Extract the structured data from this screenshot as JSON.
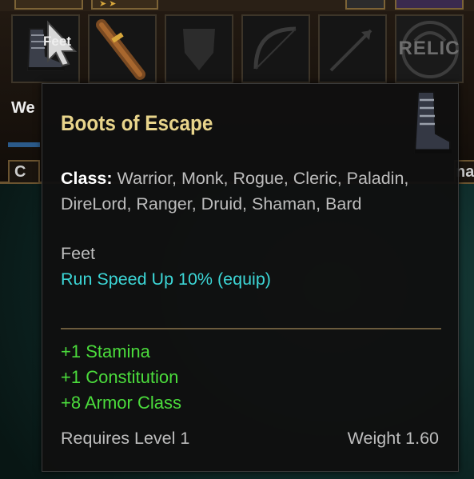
{
  "background": {
    "slot_label": "Feet",
    "relic_label": "RELIC",
    "weapon_label_partial": "We",
    "bottom_left_label": "C",
    "bottom_right_label": "na"
  },
  "tooltip": {
    "title": "Boots of Escape",
    "class_label": "Class:",
    "classes": "Warrior, Monk, Rogue, Cleric, Paladin, DireLord, Ranger, Druid, Shaman, Bard",
    "slot": "Feet",
    "effect": "Run Speed Up 10% (equip)",
    "stats": [
      "+1 Stamina",
      "+1 Constitution",
      "+8 Armor Class"
    ],
    "requires": "Requires Level 1",
    "weight": "Weight 1.60"
  },
  "colors": {
    "title": "#e8d48b",
    "effect": "#3cd6d6",
    "stat": "#4bdc3c",
    "body_text": "#bdbdbd"
  },
  "icons": [
    "boots-icon",
    "arrow-cursor-icon",
    "wooden-staff-icon",
    "shield-silhouette-icon",
    "bow-silhouette-icon",
    "arrow-silhouette-icon",
    "relic-emblem-icon"
  ]
}
